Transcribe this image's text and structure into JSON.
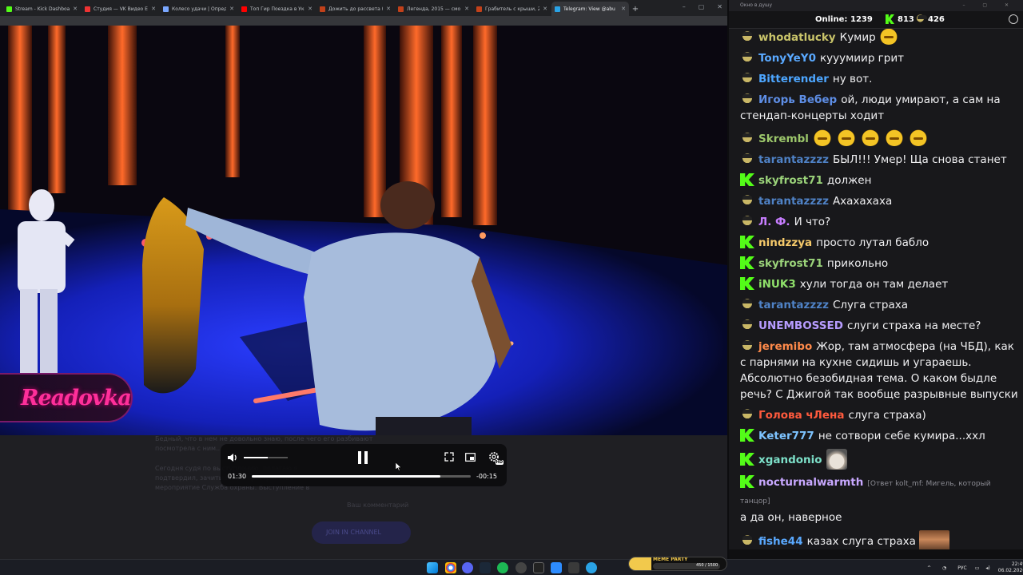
{
  "browser": {
    "tabs": [
      {
        "label": "Stream - Kick Dashboa",
        "color": "#53fc18"
      },
      {
        "label": "Студия — VK Видео Е",
        "color": "#e33"
      },
      {
        "label": "Колесо удачи | Опред",
        "color": "#7aa7ff"
      },
      {
        "label": "Топ Гир Поездка в Ук",
        "color": "#ff0000"
      },
      {
        "label": "Дожить до рассвета (",
        "color": "#c2411a"
      },
      {
        "label": "Легенда, 2015 — смо",
        "color": "#c2411a"
      },
      {
        "label": "Грабитель с крыши, 2",
        "color": "#c2411a"
      },
      {
        "label": "Telegram: View @abu",
        "color": "#2aa3e6"
      }
    ],
    "active_tab": 7,
    "new_tab": "+",
    "window_controls": [
      "–",
      "▢",
      "✕"
    ]
  },
  "player": {
    "current_time": "01:30",
    "remaining_time": "-00:15",
    "progress": 0.86,
    "volume": 0.55,
    "hd_badge": "HD"
  },
  "watermark": {
    "text": "Readovka"
  },
  "page_below": {
    "lines": [
      "Бедный, что в нем не довольно знаю, после чего его разбивают",
      "посмотрела с ним...",
      "Сегодня судя по выступлению, полагаю я",
      "подтвердил, зачитываю, в пространстве",
      "мероприятие Служба охраны. Выступление в"
    ],
    "comment_placeholder": "Ваш комментарий",
    "join_button": "JOIN IN CHANNEL"
  },
  "chat": {
    "window_title": "Окно в душу",
    "online_label": "Online:",
    "online_count": "1239",
    "kick_count": "813",
    "other_count": "426",
    "messages": [
      {
        "badge": "face",
        "user": "whodatlucky",
        "color": "#c9c46a",
        "text": "Кумир",
        "emotes": 1
      },
      {
        "badge": "face",
        "user": "TonyYeY0",
        "color": "#5aa9ff",
        "text": "кууумиир грит"
      },
      {
        "badge": "face",
        "user": "Bitterender",
        "color": "#4da6ff",
        "text": "ну вот."
      },
      {
        "badge": "face",
        "user": "Игорь Вебер",
        "color": "#5e8ee6",
        "text": "ой, люди умирают, а сам на стендап-концерты ходит"
      },
      {
        "badge": "face",
        "user": "Skrembl",
        "color": "#9cc76b",
        "text": "",
        "emotes": 5
      },
      {
        "badge": "face",
        "user": "tarantazzzz",
        "color": "#4f82c6",
        "text": "БЫЛ!!! Умер! Ща снова станет"
      },
      {
        "badge": "k",
        "user": "skyfrost71",
        "color": "#9bd37a",
        "text": "должен"
      },
      {
        "badge": "face",
        "user": "tarantazzzz",
        "color": "#4f82c6",
        "text": "Ахахахаха"
      },
      {
        "badge": "face",
        "user": "Л. Ф.",
        "color": "#c77dff",
        "text": "И что?"
      },
      {
        "badge": "k",
        "user": "nindzzya",
        "color": "#f5c96a",
        "text": "просто лутал бабло"
      },
      {
        "badge": "k",
        "user": "skyfrost71",
        "color": "#9bd37a",
        "text": "прикольно"
      },
      {
        "badge": "k",
        "user": "iNUK3",
        "color": "#8fe06a",
        "text": "хули тогда он там делает"
      },
      {
        "badge": "face",
        "user": "tarantazzzz",
        "color": "#4f82c6",
        "text": "Слуга страха"
      },
      {
        "badge": "face",
        "user": "UNEMBOSSED",
        "color": "#b79cff",
        "text": "слуги страха на месте?"
      },
      {
        "badge": "face",
        "user": "jeremibo",
        "color": "#ff8a4a",
        "text": "Жор, там атмосфера (на ЧБД), как с парнями на кухне сидишь и угараешь. Абсолютно безобидная тема. О каком быдле речь? С Джигой так вообще разрывные выпуски"
      },
      {
        "badge": "face",
        "user": "Голова чЛена",
        "color": "#ff5a3d",
        "text": "слуга страха)"
      },
      {
        "badge": "k",
        "user": "Keter777",
        "color": "#7dc3ff",
        "text": "не сотвори себе кумира...ххл"
      },
      {
        "badge": "k",
        "user": "xgandonio",
        "color": "#7de0c9",
        "text": "",
        "emote_cat": true
      },
      {
        "badge": "k",
        "user": "nocturnalwarmth",
        "color": "#c8a8ff",
        "reply": "[Ответ kolt_mf: Мигель, который танцор]",
        "text": "а да он, наверное"
      },
      {
        "badge": "face",
        "user": "fishe44",
        "color": "#5aa9ff",
        "text": "казах слуга страха",
        "emote_man": true
      }
    ]
  },
  "taskbar": {
    "language": "РУС",
    "time": "22:49",
    "date": "06.02.2026",
    "widget_title": "MEME PARTY",
    "widget_value": "450 / 1500"
  }
}
